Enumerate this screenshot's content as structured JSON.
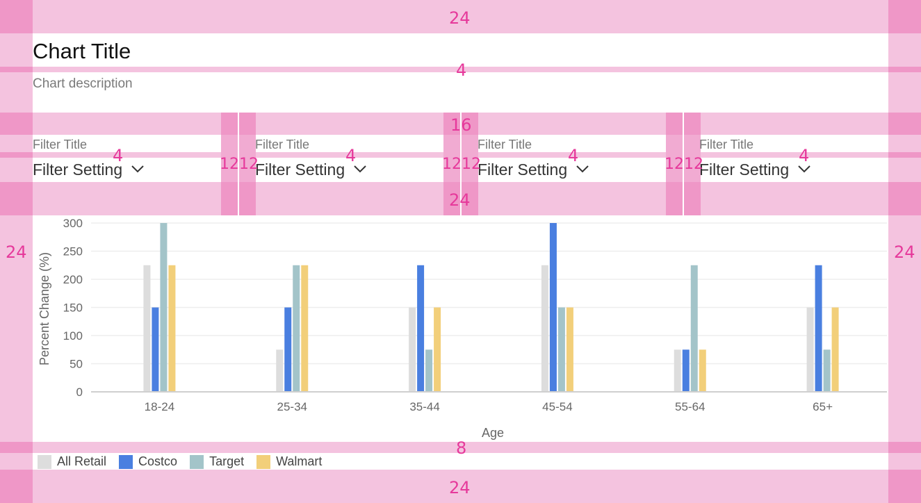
{
  "header": {
    "title": "Chart Title",
    "description": "Chart description"
  },
  "filters": [
    {
      "title": "Filter Title",
      "setting": "Filter Setting"
    },
    {
      "title": "Filter Title",
      "setting": "Filter Setting"
    },
    {
      "title": "Filter Title",
      "setting": "Filter Setting"
    },
    {
      "title": "Filter Title",
      "setting": "Filter Setting"
    }
  ],
  "spacing_annotations": {
    "top": "24",
    "title_gap": "4",
    "filters_gap": "16",
    "filter_inner_1": "4",
    "filter_inner_2": "4",
    "filter_inner_3": "4",
    "filter_inner_4": "4",
    "gutter_1": "1212",
    "gutter_2": "1212",
    "gutter_3": "1212",
    "chart_gap": "24",
    "left": "24",
    "right": "24",
    "legend_gap": "8",
    "bottom": "24"
  },
  "colors": {
    "All Retail": "#dddddd",
    "Costco": "#4a7fe0",
    "Target": "#a3c4c9",
    "Walmart": "#f2cf7a",
    "spec_overlay": "#f4c3df",
    "spec_text": "#e6399b"
  },
  "chart_data": {
    "type": "bar",
    "categories": [
      "18-24",
      "25-34",
      "35-44",
      "45-54",
      "55-64",
      "65+"
    ],
    "series": [
      {
        "name": "All Retail",
        "values": [
          225,
          75,
          150,
          225,
          75,
          150
        ]
      },
      {
        "name": "Costco",
        "values": [
          150,
          150,
          225,
          300,
          75,
          225
        ]
      },
      {
        "name": "Target",
        "values": [
          300,
          225,
          75,
          150,
          225,
          75
        ]
      },
      {
        "name": "Walmart",
        "values": [
          225,
          225,
          150,
          150,
          75,
          150
        ]
      }
    ],
    "xlabel": "Age",
    "ylabel": "Percent Change (%)",
    "ylim": [
      0,
      300
    ],
    "yticks": [
      "0",
      "50",
      "100",
      "150",
      "200",
      "250",
      "300"
    ],
    "grid": true,
    "legend": "bottom-left"
  }
}
